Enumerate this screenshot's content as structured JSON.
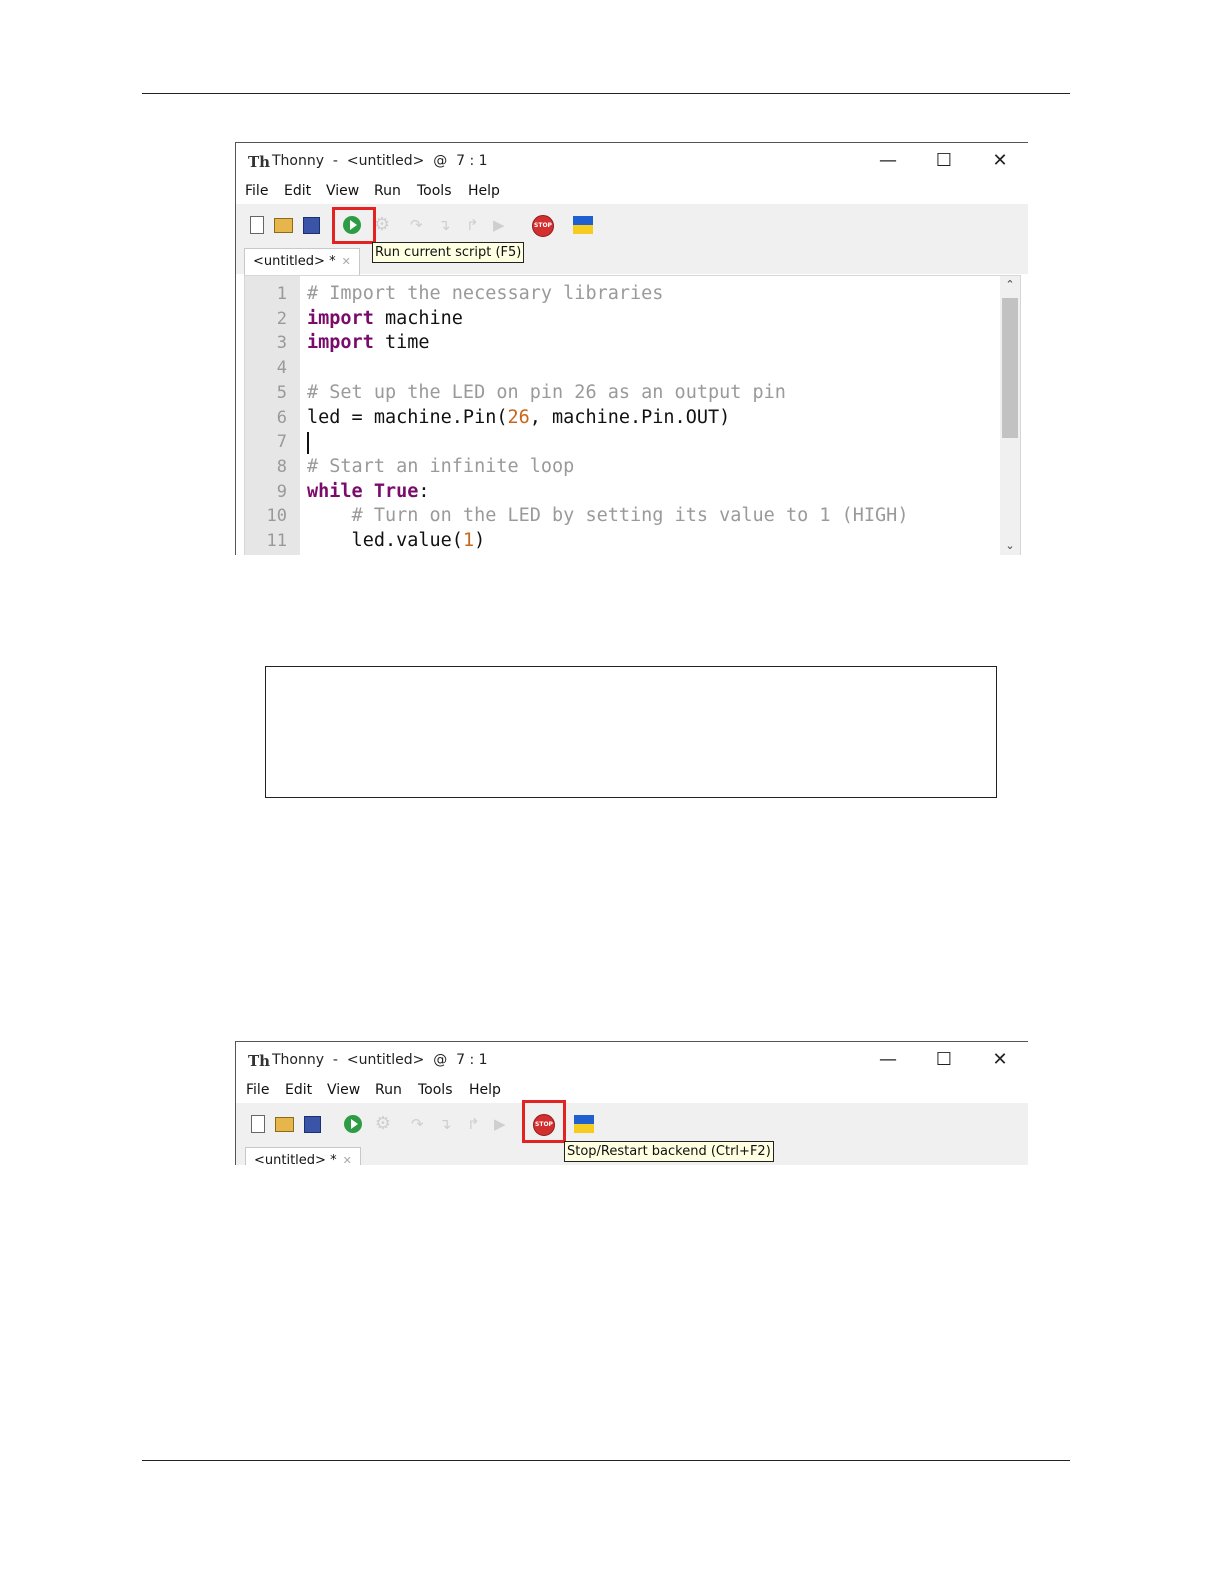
{
  "screenshot1": {
    "window_title": "Thonny  -  <untitled>  @  7 : 1",
    "menu": [
      "File",
      "Edit",
      "View",
      "Run",
      "Tools",
      "Help"
    ],
    "tooltip": "Run current script (F5)",
    "tab_label": "<untitled> *",
    "code_lines": [
      {
        "n": "1",
        "html": "<span class=\"cm\"># Import the necessary libraries</span>"
      },
      {
        "n": "2",
        "html": "<span class=\"kw\">import</span> machine"
      },
      {
        "n": "3",
        "html": "<span class=\"kw\">import</span> time"
      },
      {
        "n": "4",
        "html": ""
      },
      {
        "n": "5",
        "html": "<span class=\"cm\"># Set up the LED on pin 26 as an output pin</span>"
      },
      {
        "n": "6",
        "html": "led = machine.Pin(<span class=\"num\">26</span>, machine.Pin.OUT)"
      },
      {
        "n": "7",
        "html": ""
      },
      {
        "n": "8",
        "html": "<span class=\"cm\"># Start an infinite loop</span>"
      },
      {
        "n": "9",
        "html": "<span class=\"kw\">while</span> <span class=\"kw\">True</span>:"
      },
      {
        "n": "10",
        "html": "    <span class=\"cm\"># Turn on the LED by setting its value to 1 (HIGH)</span>"
      },
      {
        "n": "11",
        "html": "    led.value(<span class=\"num\">1</span>)"
      }
    ]
  },
  "screenshot2": {
    "window_title": "Thonny  -  <untitled>  @  7 : 1",
    "menu": [
      "File",
      "Edit",
      "View",
      "Run",
      "Tools",
      "Help"
    ],
    "tooltip": "Stop/Restart backend (Ctrl+F2)",
    "tab_label": "<untitled> *"
  },
  "icons": {
    "app": "thonny-logo-icon",
    "stop_text": "STOP"
  },
  "colors": {
    "highlight": "#e32222",
    "keyword": "#7a0b6b",
    "comment": "#9a9a9a",
    "number": "#c8671b"
  }
}
